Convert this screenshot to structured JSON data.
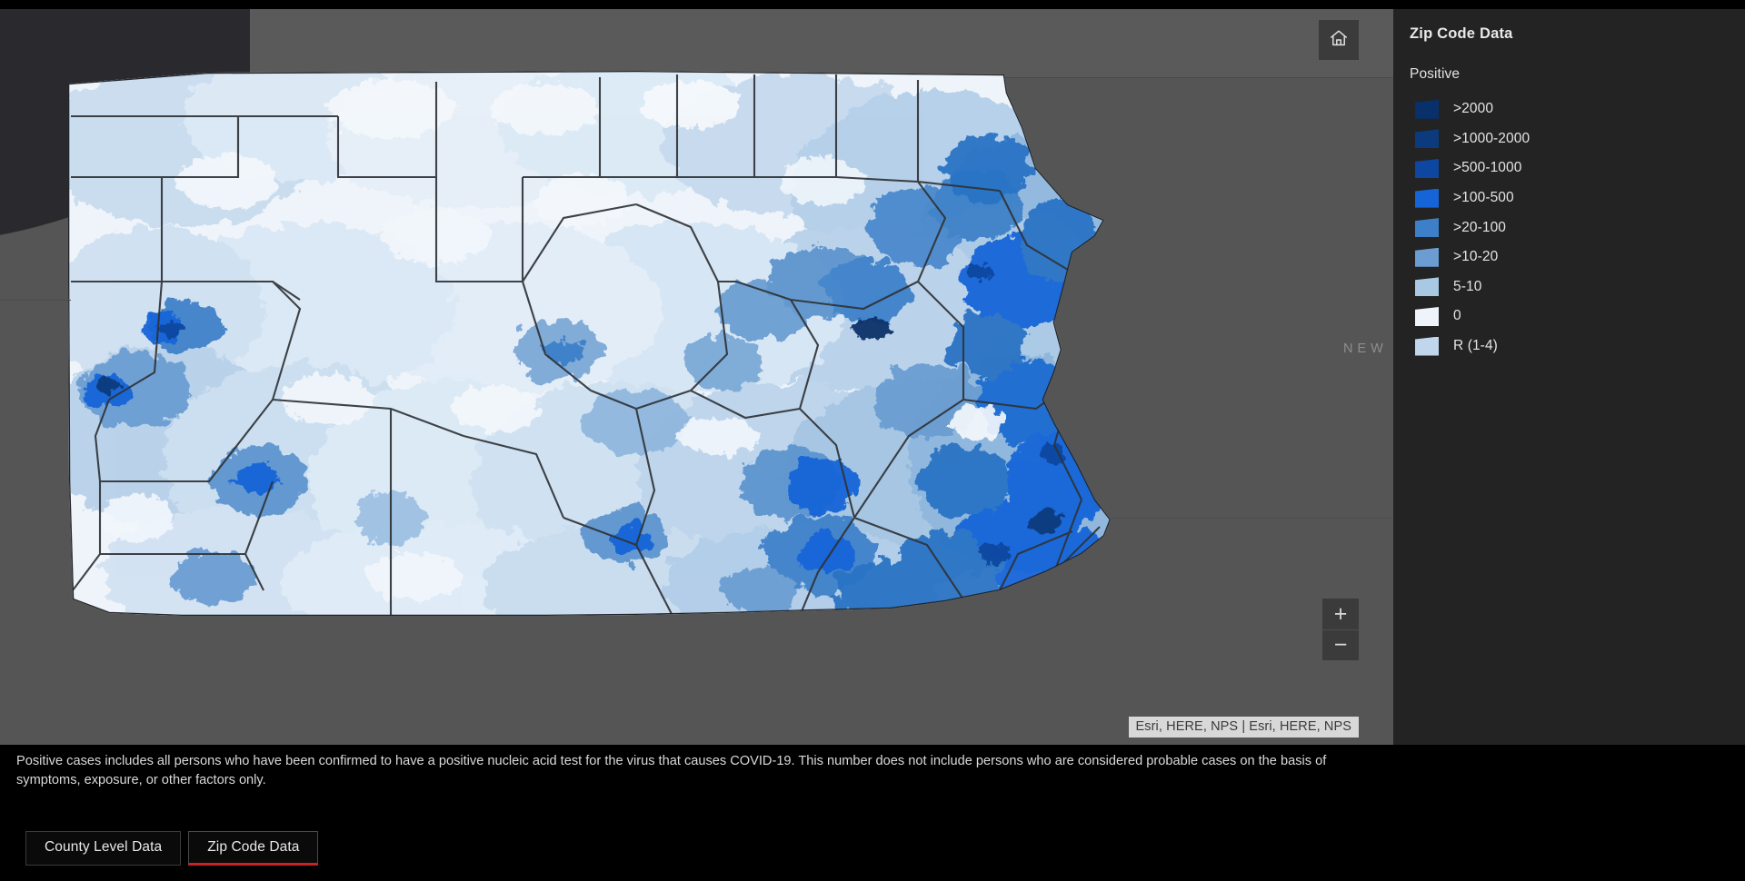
{
  "map": {
    "home_button_title": "Default map view",
    "home_icon": "home-icon",
    "zoom_in_label": "+",
    "zoom_out_label": "−",
    "attribution": "Esri, HERE, NPS | Esri, HERE, NPS",
    "state_label": "NEW",
    "basemap_land_color": "#555555",
    "water_color": "#2a2a2e",
    "boundary_color": "#2f3338"
  },
  "legend": {
    "title": "Zip Code Data",
    "field_label": "Positive",
    "items": [
      {
        "label": ">2000",
        "color": "#08306b"
      },
      {
        "label": ">1000-2000",
        "color": "#0b3b7d"
      },
      {
        "label": ">500-1000",
        "color": "#0d47a1"
      },
      {
        "label": ">100-500",
        "color": "#1565d8"
      },
      {
        "label": ">20-100",
        "color": "#3d80c9"
      },
      {
        "label": ">10-20",
        "color": "#6b9dd2"
      },
      {
        "label": "5-10",
        "color": "#a8c8e4"
      },
      {
        "label": "0",
        "color": "#eef4fa"
      },
      {
        "label": "R (1-4)",
        "color": "#c0d6ec"
      }
    ]
  },
  "footnote": {
    "text": "Positive cases includes all persons who have been confirmed to have a positive nucleic acid test for the virus that causes COVID-19.  This number does not include persons who are considered probable cases on the basis of symptoms, exposure, or other factors only."
  },
  "tabs": [
    {
      "label": "County Level Data",
      "active": false
    },
    {
      "label": "Zip Code Data",
      "active": true
    }
  ],
  "chart_data": {
    "type": "map",
    "title": "Zip Code Data",
    "subject": "COVID-19 positive cases by ZIP code, Pennsylvania",
    "legend_field": "Positive",
    "classification": "graduated-color choropleth",
    "bins": [
      {
        "label": ">2000",
        "min": 2000,
        "max": null,
        "color": "#08306b"
      },
      {
        "label": ">1000-2000",
        "min": 1000,
        "max": 2000,
        "color": "#0b3b7d"
      },
      {
        "label": ">500-1000",
        "min": 500,
        "max": 1000,
        "color": "#0d47a1"
      },
      {
        "label": ">100-500",
        "min": 100,
        "max": 500,
        "color": "#1565d8"
      },
      {
        "label": ">20-100",
        "min": 20,
        "max": 100,
        "color": "#3d80c9"
      },
      {
        "label": ">10-20",
        "min": 10,
        "max": 20,
        "color": "#6b9dd2"
      },
      {
        "label": "5-10",
        "min": 5,
        "max": 10,
        "color": "#a8c8e4"
      },
      {
        "label": "0",
        "min": 0,
        "max": 0,
        "color": "#eef4fa"
      },
      {
        "label": "R (1-4)",
        "min": 1,
        "max": 4,
        "color": "#c0d6ec"
      }
    ]
  }
}
